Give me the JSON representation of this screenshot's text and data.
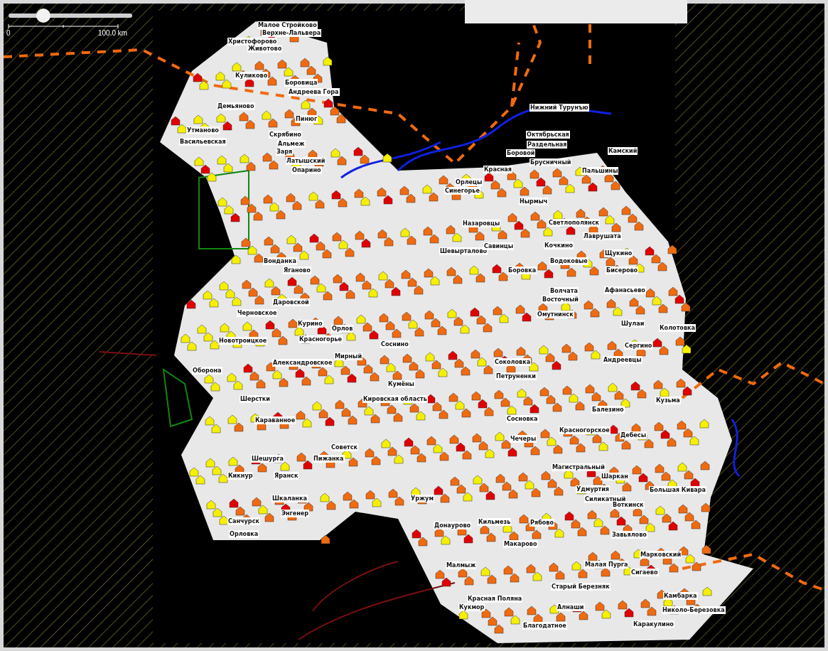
{
  "zoom_slider": {
    "level": 0.28
  },
  "scale_bar": {
    "labels": [
      "0",
      "100.0 km"
    ]
  },
  "places": [
    {
      "name": "Малое Стройково"
    },
    {
      "name": "Верхне-Лальвера"
    },
    {
      "name": "Христофорово"
    },
    {
      "name": "Животово"
    },
    {
      "name": "Куликово"
    },
    {
      "name": "Боровица"
    },
    {
      "name": "Андреева Гора"
    },
    {
      "name": "Демьяново"
    },
    {
      "name": "Нижний Турунъю"
    },
    {
      "name": "Пинюг"
    },
    {
      "name": "Утманово"
    },
    {
      "name": "Скрябино"
    },
    {
      "name": "Октябрьская"
    },
    {
      "name": "Васильевская"
    },
    {
      "name": "Альмеж"
    },
    {
      "name": "Раздельная"
    },
    {
      "name": "Заря"
    },
    {
      "name": "Боровой"
    },
    {
      "name": "Камский"
    },
    {
      "name": "Латышский"
    },
    {
      "name": "Брусничный"
    },
    {
      "name": "Опарино"
    },
    {
      "name": "Красная"
    },
    {
      "name": "Пальшины"
    },
    {
      "name": "Орлецы"
    },
    {
      "name": "Синегорье"
    },
    {
      "name": "Нырмыч"
    },
    {
      "name": "Назаровцы"
    },
    {
      "name": "Светлополянск"
    },
    {
      "name": "Лаврушата"
    },
    {
      "name": "Шевырталово"
    },
    {
      "name": "Савинцы"
    },
    {
      "name": "Кочкино"
    },
    {
      "name": "Щукино"
    },
    {
      "name": "Вонданка"
    },
    {
      "name": "Водоковые"
    },
    {
      "name": "Яганово"
    },
    {
      "name": "Боровка"
    },
    {
      "name": "Бисерово"
    },
    {
      "name": "Волчата"
    },
    {
      "name": "Афанасьево"
    },
    {
      "name": "Даровской"
    },
    {
      "name": "Восточный"
    },
    {
      "name": "Черновское"
    },
    {
      "name": "Омутнинск"
    },
    {
      "name": "Курино"
    },
    {
      "name": "Орлов"
    },
    {
      "name": "Шулаи"
    },
    {
      "name": "Колотовка"
    },
    {
      "name": "Новотроицкое"
    },
    {
      "name": "Красногорье"
    },
    {
      "name": "Соснино"
    },
    {
      "name": "Сергино"
    },
    {
      "name": "Александровское"
    },
    {
      "name": "Мирный"
    },
    {
      "name": "Соколовка"
    },
    {
      "name": "Андреевцы"
    },
    {
      "name": "Оборона"
    },
    {
      "name": "Петруненки"
    },
    {
      "name": "Кумёны"
    },
    {
      "name": "Шерстки"
    },
    {
      "name": "Кировская область"
    },
    {
      "name": "Кузьма"
    },
    {
      "name": "Балезино"
    },
    {
      "name": "Караванное"
    },
    {
      "name": "Сосновка"
    },
    {
      "name": "Красногорское"
    },
    {
      "name": "Чечеры"
    },
    {
      "name": "Дебесы"
    },
    {
      "name": "Советск"
    },
    {
      "name": "Шешурга"
    },
    {
      "name": "Пижанка"
    },
    {
      "name": "Магистральный"
    },
    {
      "name": "Кикнур"
    },
    {
      "name": "Яранск"
    },
    {
      "name": "Шаркан"
    },
    {
      "name": "Удмуртия"
    },
    {
      "name": "Большая Кивара"
    },
    {
      "name": "Шкаланка"
    },
    {
      "name": "Уржум"
    },
    {
      "name": "Силикатный"
    },
    {
      "name": "Воткинск"
    },
    {
      "name": "Энгенер"
    },
    {
      "name": "Санчурск"
    },
    {
      "name": "Донаурово"
    },
    {
      "name": "Кильмезь"
    },
    {
      "name": "Рябово"
    },
    {
      "name": "Орловка"
    },
    {
      "name": "Завьялово"
    },
    {
      "name": "Макарово"
    },
    {
      "name": "Марковский"
    },
    {
      "name": "Малмыж"
    },
    {
      "name": "Малая Пурга"
    },
    {
      "name": "Сигаево"
    },
    {
      "name": "Старый Березняк"
    },
    {
      "name": "Красная Поляна"
    },
    {
      "name": "Камбарка"
    },
    {
      "name": "Кукмор"
    },
    {
      "name": "Алнаши"
    },
    {
      "name": "Николо-Березовка"
    },
    {
      "name": "Благодатное"
    },
    {
      "name": "Каракулино"
    }
  ]
}
